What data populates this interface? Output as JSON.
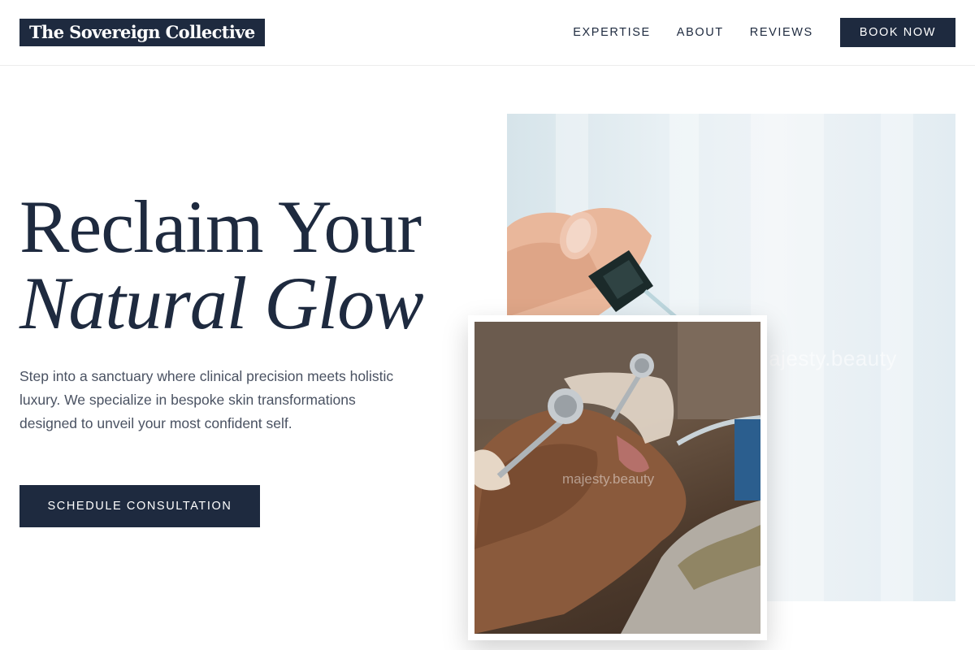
{
  "header": {
    "brand": "The Sovereign Collective",
    "nav": [
      {
        "label": "EXPERTISE"
      },
      {
        "label": "ABOUT"
      },
      {
        "label": "REVIEWS"
      }
    ],
    "cta_label": "BOOK NOW"
  },
  "hero": {
    "title_line1": "Reclaim Your",
    "title_line2": "Natural Glow",
    "description": "Step into a sanctuary where clinical precision meets holistic luxury. We specialize in bespoke skin transformations designed to unveil your most confident self.",
    "cta_label": "SCHEDULE CONSULTATION"
  },
  "images": {
    "back_watermark": "majesty.beauty",
    "front_watermark": "majesty.beauty"
  },
  "colors": {
    "primary": "#1e2a3f",
    "text_muted": "#4a5262",
    "background": "#ffffff"
  }
}
